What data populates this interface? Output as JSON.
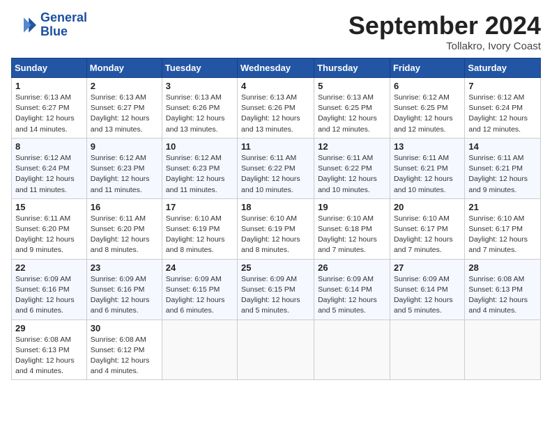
{
  "header": {
    "logo_line1": "General",
    "logo_line2": "Blue",
    "month": "September 2024",
    "location": "Tollakro, Ivory Coast"
  },
  "weekdays": [
    "Sunday",
    "Monday",
    "Tuesday",
    "Wednesday",
    "Thursday",
    "Friday",
    "Saturday"
  ],
  "weeks": [
    [
      {
        "day": "1",
        "sunrise": "6:13 AM",
        "sunset": "6:27 PM",
        "daylight": "12 hours and 14 minutes."
      },
      {
        "day": "2",
        "sunrise": "6:13 AM",
        "sunset": "6:27 PM",
        "daylight": "12 hours and 13 minutes."
      },
      {
        "day": "3",
        "sunrise": "6:13 AM",
        "sunset": "6:26 PM",
        "daylight": "12 hours and 13 minutes."
      },
      {
        "day": "4",
        "sunrise": "6:13 AM",
        "sunset": "6:26 PM",
        "daylight": "12 hours and 13 minutes."
      },
      {
        "day": "5",
        "sunrise": "6:13 AM",
        "sunset": "6:25 PM",
        "daylight": "12 hours and 12 minutes."
      },
      {
        "day": "6",
        "sunrise": "6:12 AM",
        "sunset": "6:25 PM",
        "daylight": "12 hours and 12 minutes."
      },
      {
        "day": "7",
        "sunrise": "6:12 AM",
        "sunset": "6:24 PM",
        "daylight": "12 hours and 12 minutes."
      }
    ],
    [
      {
        "day": "8",
        "sunrise": "6:12 AM",
        "sunset": "6:24 PM",
        "daylight": "12 hours and 11 minutes."
      },
      {
        "day": "9",
        "sunrise": "6:12 AM",
        "sunset": "6:23 PM",
        "daylight": "12 hours and 11 minutes."
      },
      {
        "day": "10",
        "sunrise": "6:12 AM",
        "sunset": "6:23 PM",
        "daylight": "12 hours and 11 minutes."
      },
      {
        "day": "11",
        "sunrise": "6:11 AM",
        "sunset": "6:22 PM",
        "daylight": "12 hours and 10 minutes."
      },
      {
        "day": "12",
        "sunrise": "6:11 AM",
        "sunset": "6:22 PM",
        "daylight": "12 hours and 10 minutes."
      },
      {
        "day": "13",
        "sunrise": "6:11 AM",
        "sunset": "6:21 PM",
        "daylight": "12 hours and 10 minutes."
      },
      {
        "day": "14",
        "sunrise": "6:11 AM",
        "sunset": "6:21 PM",
        "daylight": "12 hours and 9 minutes."
      }
    ],
    [
      {
        "day": "15",
        "sunrise": "6:11 AM",
        "sunset": "6:20 PM",
        "daylight": "12 hours and 9 minutes."
      },
      {
        "day": "16",
        "sunrise": "6:11 AM",
        "sunset": "6:20 PM",
        "daylight": "12 hours and 8 minutes."
      },
      {
        "day": "17",
        "sunrise": "6:10 AM",
        "sunset": "6:19 PM",
        "daylight": "12 hours and 8 minutes."
      },
      {
        "day": "18",
        "sunrise": "6:10 AM",
        "sunset": "6:19 PM",
        "daylight": "12 hours and 8 minutes."
      },
      {
        "day": "19",
        "sunrise": "6:10 AM",
        "sunset": "6:18 PM",
        "daylight": "12 hours and 7 minutes."
      },
      {
        "day": "20",
        "sunrise": "6:10 AM",
        "sunset": "6:17 PM",
        "daylight": "12 hours and 7 minutes."
      },
      {
        "day": "21",
        "sunrise": "6:10 AM",
        "sunset": "6:17 PM",
        "daylight": "12 hours and 7 minutes."
      }
    ],
    [
      {
        "day": "22",
        "sunrise": "6:09 AM",
        "sunset": "6:16 PM",
        "daylight": "12 hours and 6 minutes."
      },
      {
        "day": "23",
        "sunrise": "6:09 AM",
        "sunset": "6:16 PM",
        "daylight": "12 hours and 6 minutes."
      },
      {
        "day": "24",
        "sunrise": "6:09 AM",
        "sunset": "6:15 PM",
        "daylight": "12 hours and 6 minutes."
      },
      {
        "day": "25",
        "sunrise": "6:09 AM",
        "sunset": "6:15 PM",
        "daylight": "12 hours and 5 minutes."
      },
      {
        "day": "26",
        "sunrise": "6:09 AM",
        "sunset": "6:14 PM",
        "daylight": "12 hours and 5 minutes."
      },
      {
        "day": "27",
        "sunrise": "6:09 AM",
        "sunset": "6:14 PM",
        "daylight": "12 hours and 5 minutes."
      },
      {
        "day": "28",
        "sunrise": "6:08 AM",
        "sunset": "6:13 PM",
        "daylight": "12 hours and 4 minutes."
      }
    ],
    [
      {
        "day": "29",
        "sunrise": "6:08 AM",
        "sunset": "6:13 PM",
        "daylight": "12 hours and 4 minutes."
      },
      {
        "day": "30",
        "sunrise": "6:08 AM",
        "sunset": "6:12 PM",
        "daylight": "12 hours and 4 minutes."
      },
      null,
      null,
      null,
      null,
      null
    ]
  ]
}
